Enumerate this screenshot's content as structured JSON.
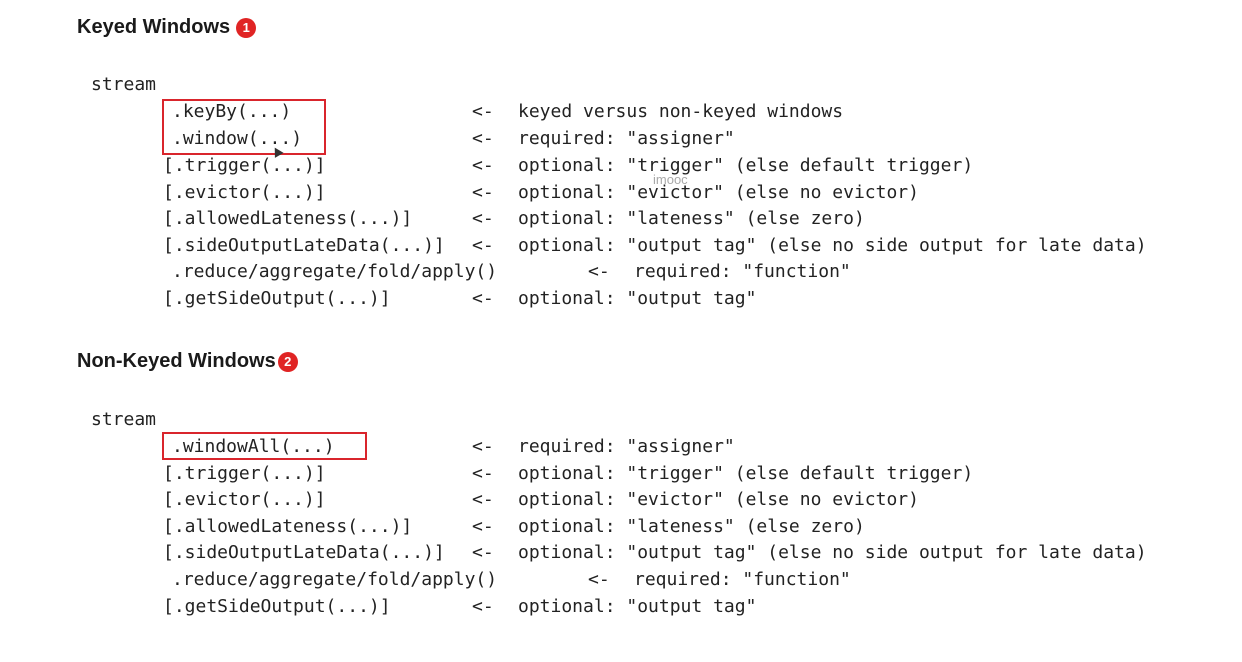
{
  "keyed": {
    "title": "Keyed Windows",
    "badge": "1",
    "stream": "stream",
    "rows": [
      {
        "call": ".keyBy(...)",
        "arrow": "<-",
        "desc": "keyed versus non-keyed windows"
      },
      {
        "call": ".window(...)",
        "arrow": "<-",
        "desc": "required: \"assigner\""
      },
      {
        "call": "[.trigger(...)]",
        "arrow": "<-",
        "desc": "optional: \"trigger\" (else default trigger)"
      },
      {
        "call": "[.evictor(...)]",
        "arrow": "<-",
        "desc": "optional: \"evictor\" (else no evictor)"
      },
      {
        "call": "[.allowedLateness(...)]",
        "arrow": "<-",
        "desc": "optional: \"lateness\" (else zero)"
      },
      {
        "call": "[.sideOutputLateData(...)]",
        "arrow": "<-",
        "desc": "optional: \"output tag\" (else no side output for late data)"
      },
      {
        "call": ".reduce/aggregate/fold/apply()",
        "arrow": "<-",
        "desc": "required: \"function\""
      },
      {
        "call": "[.getSideOutput(...)]",
        "arrow": "<-",
        "desc": "optional: \"output tag\""
      }
    ]
  },
  "nonkeyed": {
    "title": "Non-Keyed Windows",
    "badge": "2",
    "stream": "stream",
    "rows": [
      {
        "call": ".windowAll(...)",
        "arrow": "<-",
        "desc": "required: \"assigner\""
      },
      {
        "call": "[.trigger(...)]",
        "arrow": "<-",
        "desc": "optional: \"trigger\" (else default trigger)"
      },
      {
        "call": "[.evictor(...)]",
        "arrow": "<-",
        "desc": "optional: \"evictor\" (else no evictor)"
      },
      {
        "call": "[.allowedLateness(...)]",
        "arrow": "<-",
        "desc": "optional: \"lateness\" (else zero)"
      },
      {
        "call": "[.sideOutputLateData(...)]",
        "arrow": "<-",
        "desc": "optional: \"output tag\" (else no side output for late data)"
      },
      {
        "call": ".reduce/aggregate/fold/apply()",
        "arrow": "<-",
        "desc": "required: \"function\""
      },
      {
        "call": "[.getSideOutput(...)]",
        "arrow": "<-",
        "desc": "optional: \"output tag\""
      }
    ]
  },
  "watermark": "imooc",
  "colors": {
    "highlight": "#d9252c",
    "badge": "#e02424"
  }
}
